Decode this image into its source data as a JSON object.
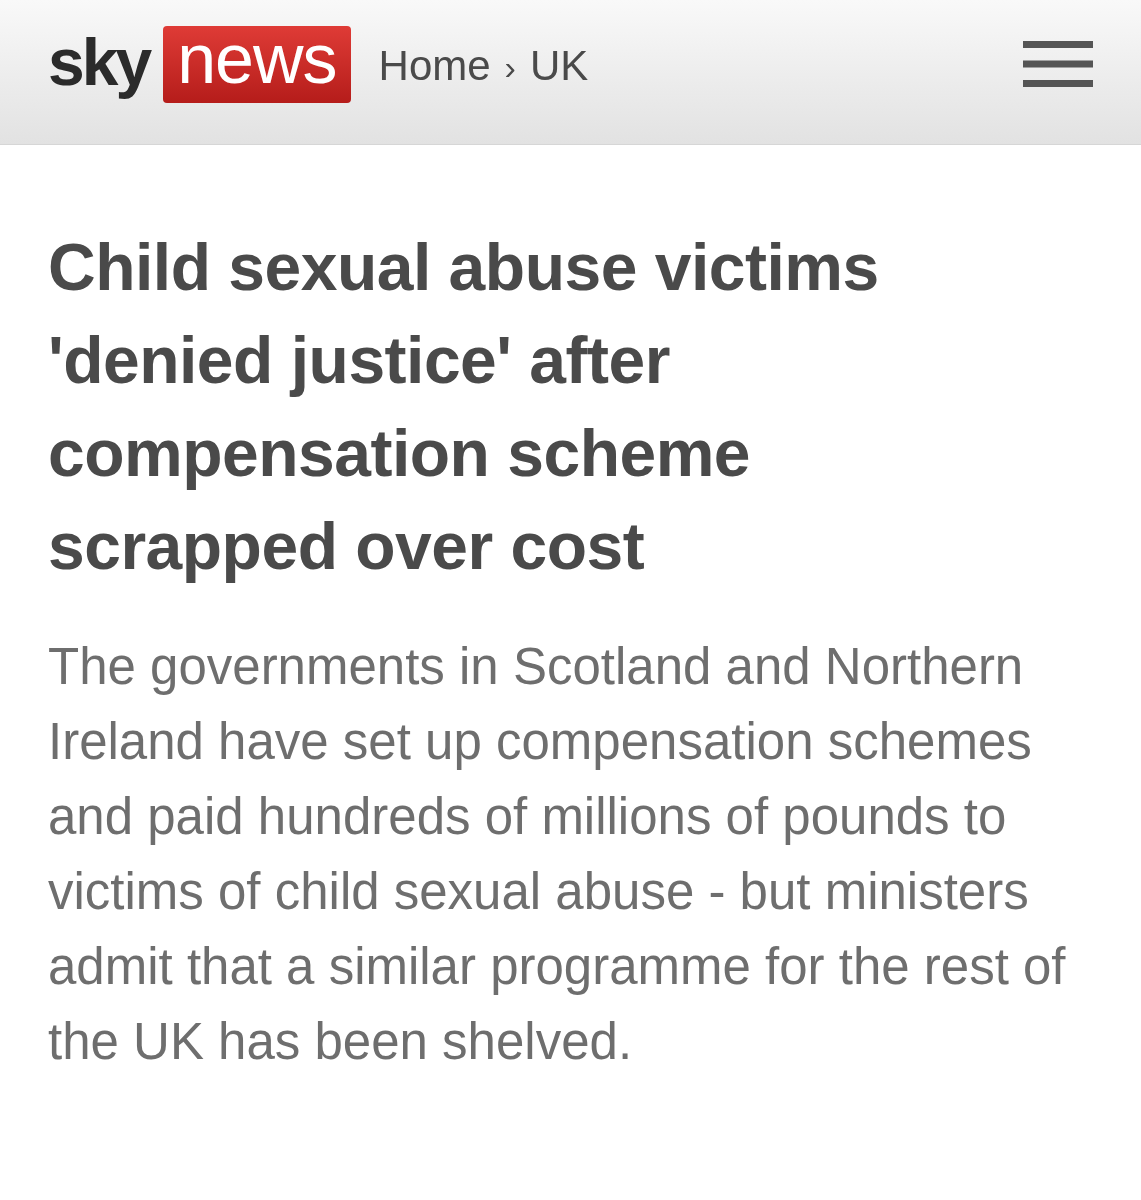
{
  "header": {
    "logo": {
      "wordmark": "sky",
      "badge": "news"
    },
    "breadcrumb": [
      {
        "kind": "link",
        "text": "Home"
      },
      {
        "kind": "separator",
        "text": "›"
      },
      {
        "kind": "link",
        "text": "UK"
      }
    ]
  },
  "article": {
    "headline": "Child sexual abuse victims 'denied justice' after compensation scheme scrapped over cost",
    "standfirst": "The governments in Scotland and Northern Ireland have set up compensation schemes and paid hundreds of millions of pounds to victims of child sexual abuse - but ministers admit that a similar programme for the rest of the UK has been shelved."
  }
}
